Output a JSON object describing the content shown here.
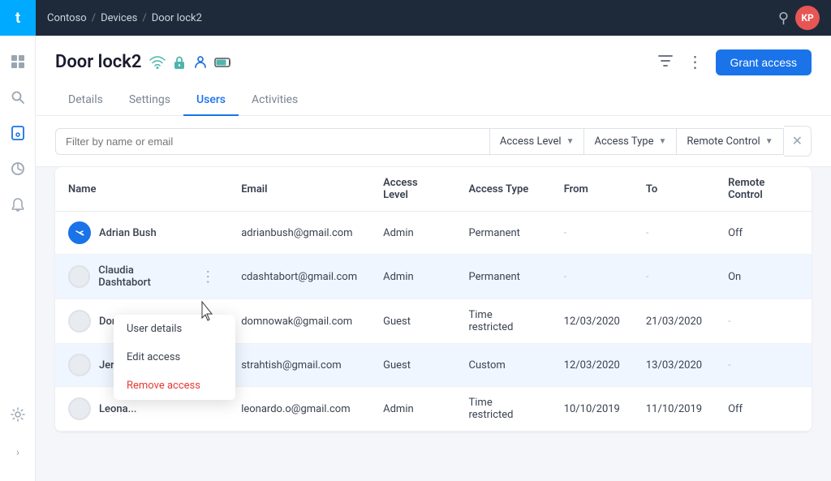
{
  "topbar": {
    "logo": "t",
    "breadcrumb": [
      "Contoso",
      "Devices",
      "Door lock2"
    ],
    "avatar_initials": "KP"
  },
  "sidebar": {
    "items": [
      {
        "icon": "⊞",
        "name": "grid-icon",
        "active": false
      },
      {
        "icon": "⌕",
        "name": "search-icon",
        "active": false
      },
      {
        "icon": "⊙",
        "name": "device-icon",
        "active": true
      },
      {
        "icon": "◑",
        "name": "analytics-icon",
        "active": false
      },
      {
        "icon": "♟",
        "name": "bell-icon",
        "active": false
      },
      {
        "icon": "⚙",
        "name": "settings-icon",
        "active": false
      }
    ],
    "expand_label": "›"
  },
  "page": {
    "title": "Door lock2",
    "tabs": [
      "Details",
      "Settings",
      "Users",
      "Activities"
    ],
    "active_tab": "Users",
    "grant_button": "Grant access"
  },
  "filter": {
    "search_placeholder": "Filter by name or email",
    "dropdowns": [
      {
        "label": "Access Level",
        "value": ""
      },
      {
        "label": "Access Type",
        "value": ""
      },
      {
        "label": "Remote Control",
        "value": ""
      }
    ]
  },
  "table": {
    "columns": [
      "Name",
      "Email",
      "Access Level",
      "Access Type",
      "From",
      "To",
      "Remote Control"
    ],
    "rows": [
      {
        "name": "Adrian Bush",
        "email": "adrianbush@gmail.com",
        "access_level": "Admin",
        "access_type": "Permanent",
        "from": "-",
        "to": "-",
        "remote_control": "Off",
        "active": true
      },
      {
        "name": "Claudia Dashtabort",
        "email": "cdashtabort@gmail.com",
        "access_level": "Admin",
        "access_type": "Permanent",
        "from": "-",
        "to": "-",
        "remote_control": "On",
        "active": false,
        "highlighted": true
      },
      {
        "name": "Dominic Novakowski",
        "email": "domnowak@gmail.com",
        "access_level": "Guest",
        "access_type": "Time restricted",
        "from": "12/03/2020",
        "to": "21/03/2020",
        "remote_control": "-",
        "active": false
      },
      {
        "name": "Jeremi Strahtish",
        "email": "strahtish@gmail.com",
        "access_level": "Guest",
        "access_type": "Custom",
        "from": "12/03/2020",
        "to": "13/03/2020",
        "remote_control": "-",
        "active": false,
        "highlighted": true,
        "menu_open": true
      },
      {
        "name": "Leona...",
        "email": "leonardo.o@gmail.com",
        "access_level": "Admin",
        "access_type": "Time restricted",
        "from": "10/10/2019",
        "to": "11/10/2019",
        "remote_control": "Off",
        "active": false
      }
    ]
  },
  "context_menu": {
    "items": [
      {
        "label": "User details",
        "danger": false
      },
      {
        "label": "Edit access",
        "danger": false
      },
      {
        "label": "Remove access",
        "danger": true
      }
    ]
  }
}
